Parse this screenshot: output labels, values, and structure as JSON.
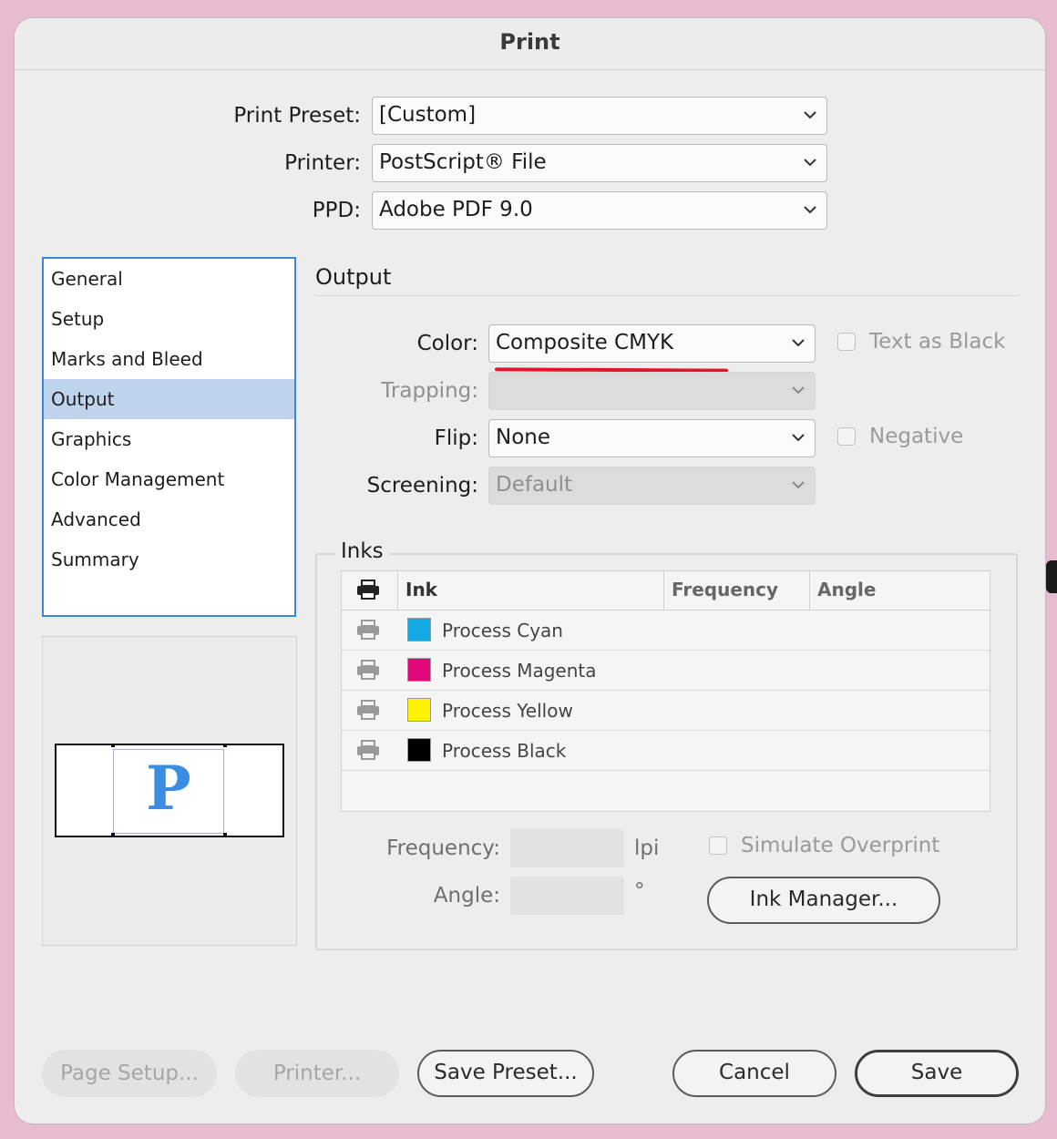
{
  "window": {
    "title": "Print"
  },
  "header": {
    "preset_label": "Print Preset:",
    "preset_value": "[Custom]",
    "printer_label": "Printer:",
    "printer_value": "PostScript® File",
    "ppd_label": "PPD:",
    "ppd_value": "Adobe PDF 9.0"
  },
  "sidebar": {
    "items": [
      {
        "label": "General"
      },
      {
        "label": "Setup"
      },
      {
        "label": "Marks and Bleed"
      },
      {
        "label": "Output",
        "selected": true
      },
      {
        "label": "Graphics"
      },
      {
        "label": "Color Management"
      },
      {
        "label": "Advanced"
      },
      {
        "label": "Summary"
      }
    ]
  },
  "preview": {
    "glyph": "P"
  },
  "output": {
    "title": "Output",
    "color_label": "Color:",
    "color_value": "Composite CMYK",
    "text_as_black_label": "Text as Black",
    "trapping_label": "Trapping:",
    "trapping_value": "",
    "flip_label": "Flip:",
    "flip_value": "None",
    "negative_label": "Negative",
    "screening_label": "Screening:",
    "screening_value": "Default"
  },
  "inks": {
    "title": "Inks",
    "columns": {
      "ink": "Ink",
      "frequency": "Frequency",
      "angle": "Angle"
    },
    "rows": [
      {
        "name": "Process Cyan",
        "color": "#12abe3"
      },
      {
        "name": "Process Magenta",
        "color": "#e2077a"
      },
      {
        "name": "Process Yellow",
        "color": "#fff200"
      },
      {
        "name": "Process Black",
        "color": "#000000"
      }
    ],
    "frequency_label": "Frequency:",
    "frequency_unit": "lpi",
    "angle_label": "Angle:",
    "angle_unit": "°",
    "simulate_overprint_label": "Simulate Overprint",
    "ink_manager_label": "Ink Manager..."
  },
  "buttons": {
    "page_setup": "Page Setup...",
    "printer": "Printer...",
    "save_preset": "Save Preset...",
    "cancel": "Cancel",
    "save": "Save"
  },
  "colors": {
    "selection": "#bed3ec",
    "focus_border": "#3c86d6",
    "annotation_red": "#e1162b",
    "preview_glyph": "#3a8de0"
  }
}
